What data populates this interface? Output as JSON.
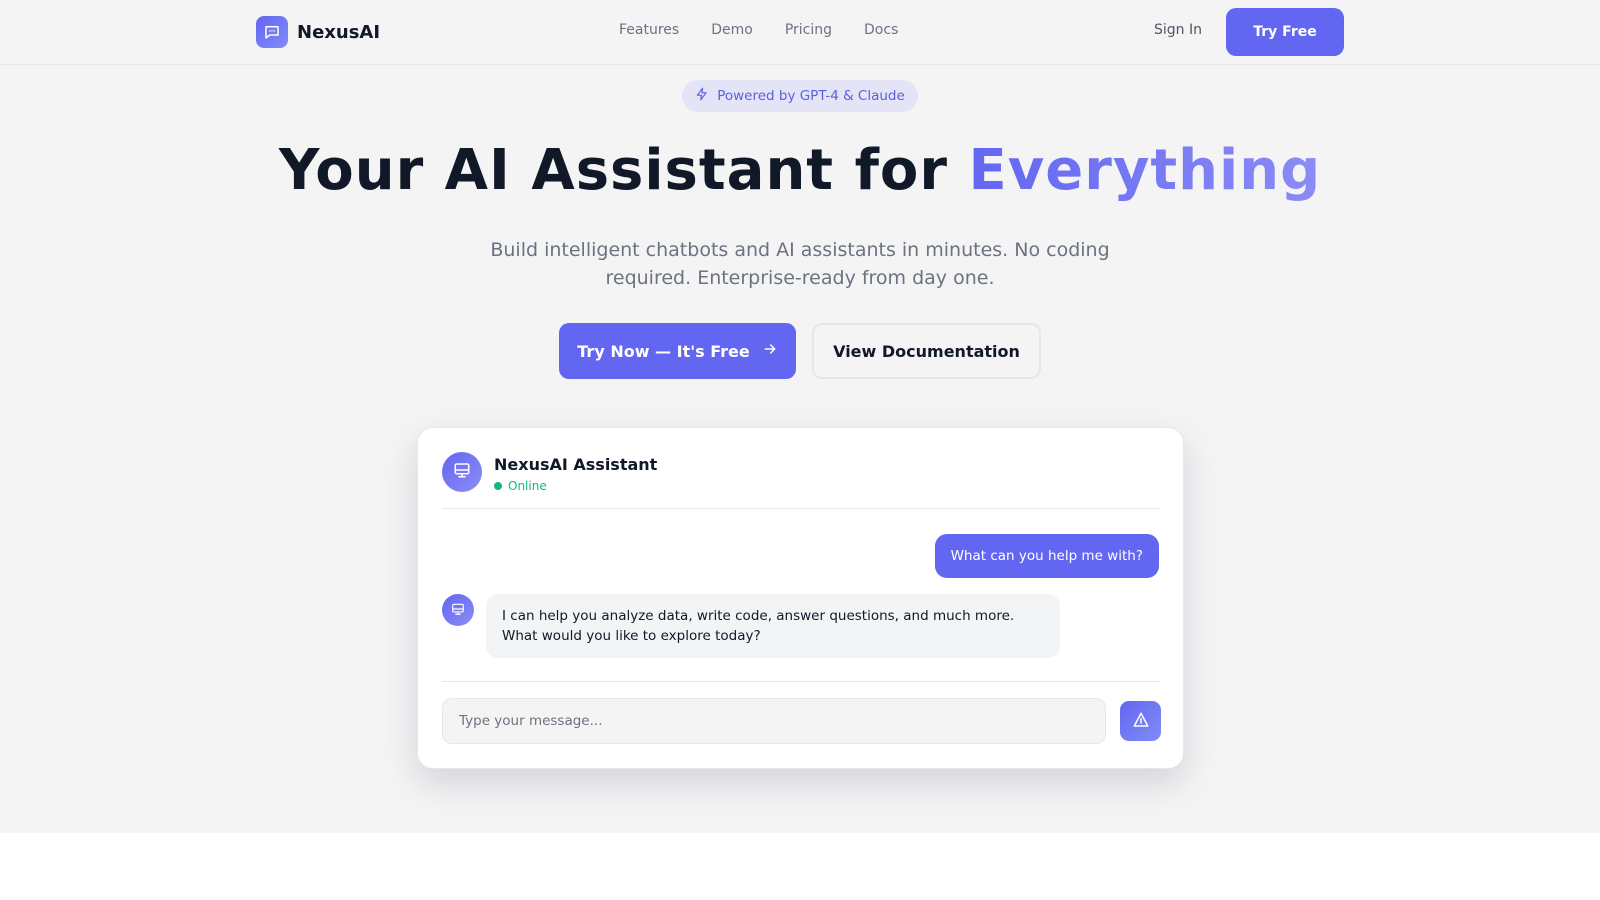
{
  "brand": {
    "name": "NexusAI"
  },
  "nav": {
    "links": [
      "Features",
      "Demo",
      "Pricing",
      "Docs"
    ],
    "sign_in": "Sign In",
    "try_free": "Try Free"
  },
  "hero": {
    "badge": "Powered by GPT-4 & Claude",
    "headline_main": "Your AI Assistant for ",
    "headline_accent": "Everything",
    "subtitle": "Build intelligent chatbots and AI assistants in minutes. No coding required. Enterprise-ready from day one.",
    "cta_primary": "Try Now — It's Free",
    "cta_secondary": "View Documentation"
  },
  "chat": {
    "assistant_name": "NexusAI Assistant",
    "status": "Online",
    "user_message": "What can you help me with?",
    "bot_message": "I can help you analyze data, write code, answer questions, and much more. What would you like to explore today?",
    "input_placeholder": "Type your message..."
  },
  "colors": {
    "accent": "#6366f1",
    "accent_light": "#8b8cf6",
    "online": "#10b981",
    "background": "#f4f4f5"
  },
  "icons": {
    "logo": "chat-bubble-icon",
    "badge": "lightning-icon",
    "cta_arrow": "arrow-right-icon",
    "avatar": "monitor-icon",
    "send": "send-icon"
  }
}
